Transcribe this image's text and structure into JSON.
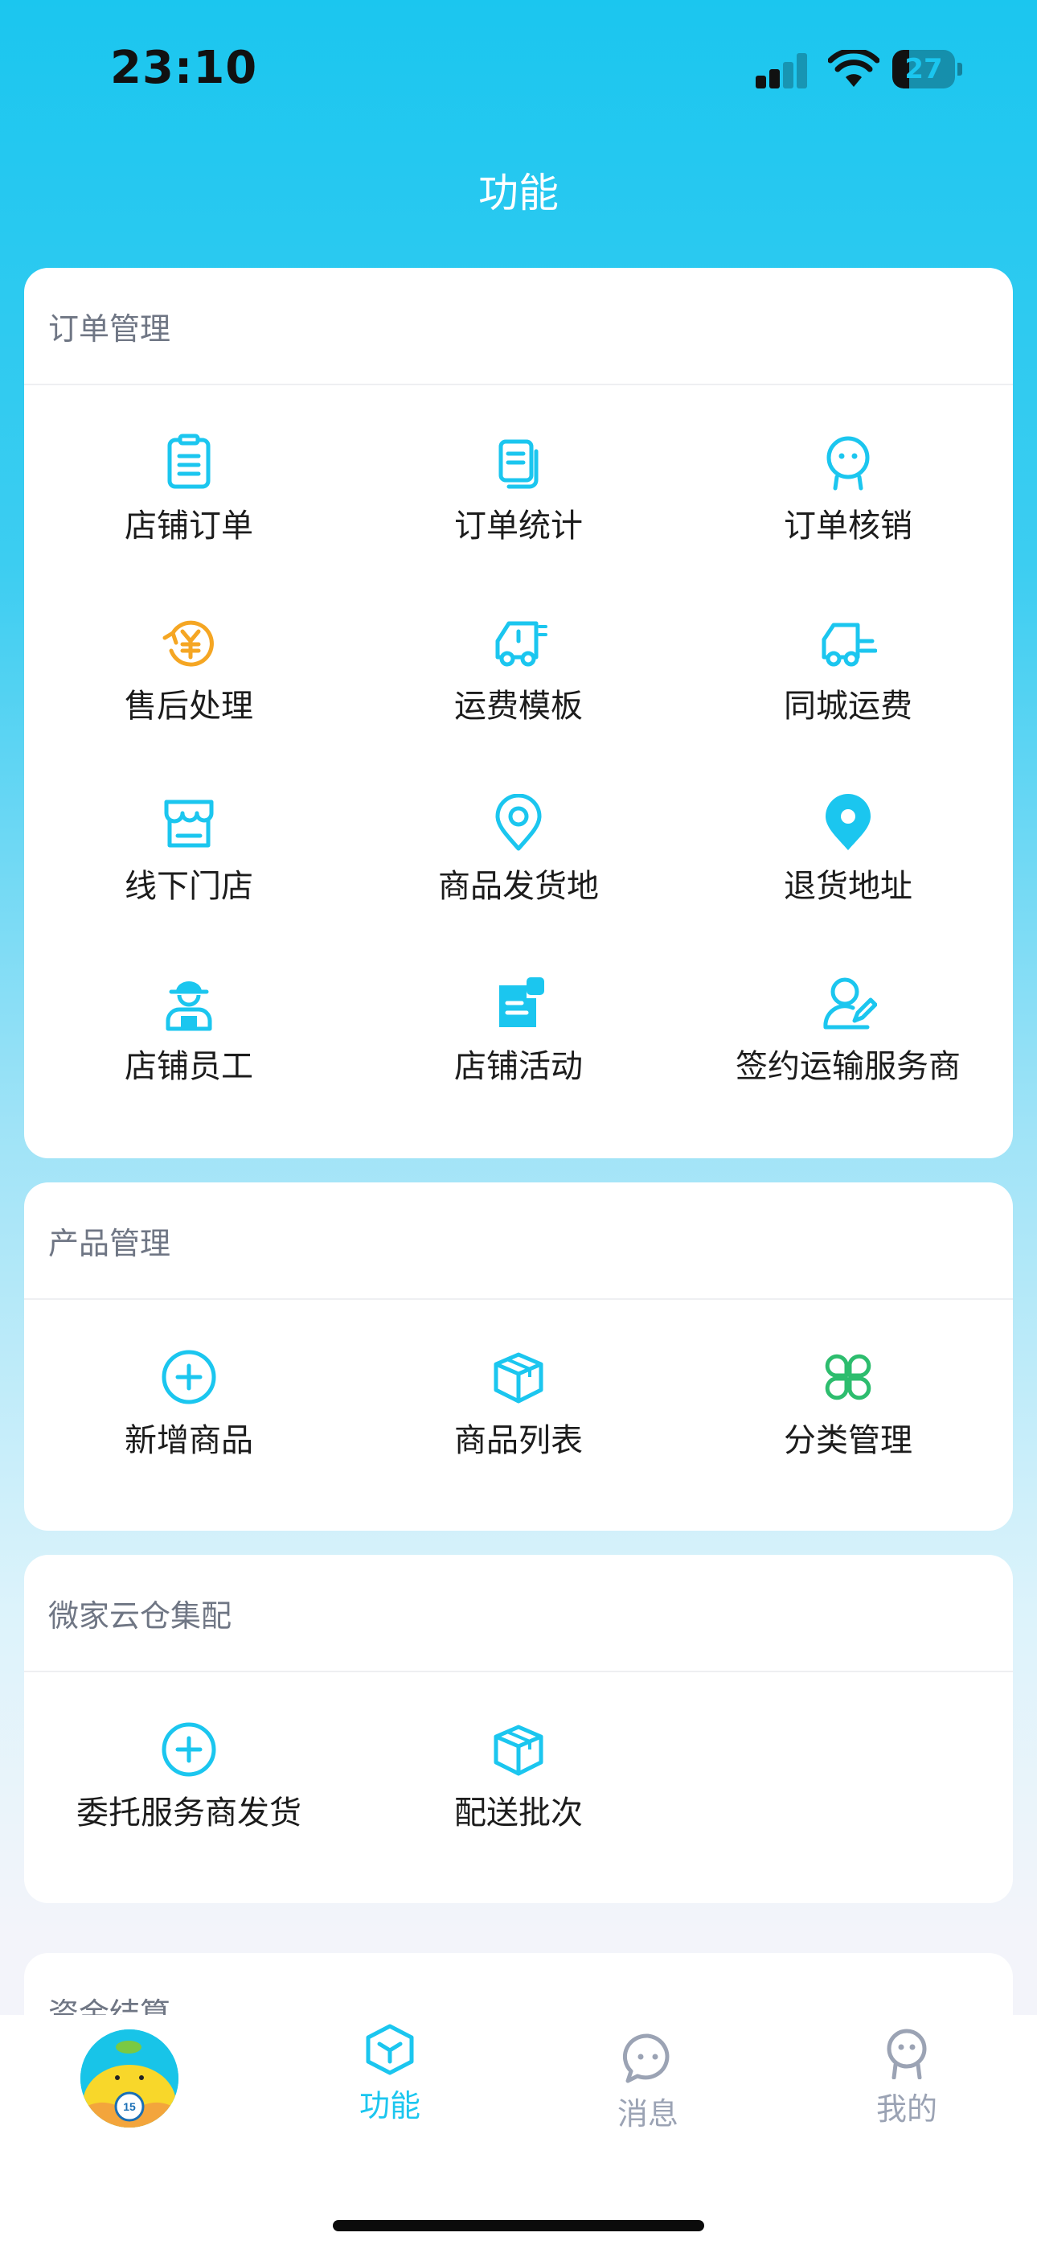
{
  "status_bar": {
    "time": "23:10",
    "battery": "27",
    "battery_level": 0.27
  },
  "page": {
    "title": "功能"
  },
  "sections": [
    {
      "title": "订单管理",
      "items": [
        {
          "label": "店铺订单",
          "icon": "clipboard-icon"
        },
        {
          "label": "订单统计",
          "icon": "documents-icon"
        },
        {
          "label": "订单核销",
          "icon": "person-verify-icon"
        },
        {
          "label": "售后处理",
          "icon": "yuan-refund-icon"
        },
        {
          "label": "运费模板",
          "icon": "delivery-truck-icon"
        },
        {
          "label": "同城运费",
          "icon": "local-delivery-truck-icon"
        },
        {
          "label": "线下门店",
          "icon": "storefront-icon"
        },
        {
          "label": "商品发货地",
          "icon": "location-pin-outline-icon"
        },
        {
          "label": "退货地址",
          "icon": "location-pin-filled-icon"
        },
        {
          "label": "店铺员工",
          "icon": "staff-icon"
        },
        {
          "label": "店铺活动",
          "icon": "activity-note-icon"
        },
        {
          "label": "签约运输服务商",
          "icon": "contract-sign-icon"
        }
      ]
    },
    {
      "title": "产品管理",
      "items": [
        {
          "label": "新增商品",
          "icon": "add-circle-icon"
        },
        {
          "label": "商品列表",
          "icon": "box-icon"
        },
        {
          "label": "分类管理",
          "icon": "category-clover-icon"
        }
      ]
    },
    {
      "title": "微家云仓集配",
      "items": [
        {
          "label": "委托服务商发货",
          "icon": "add-circle-icon"
        },
        {
          "label": "配送批次",
          "icon": "box-icon"
        }
      ]
    },
    {
      "title": "资金结算",
      "items": []
    }
  ],
  "tabbar": {
    "items": [
      {
        "label": "功能",
        "icon": "cube-icon",
        "active": true
      },
      {
        "label": "消息",
        "icon": "chat-bubble-icon",
        "active": false
      },
      {
        "label": "我的",
        "icon": "profile-icon",
        "active": false
      }
    ]
  },
  "colors": {
    "accent": "#1bc6ef",
    "orange": "#f5a623",
    "green": "#2dbd6e",
    "title_gray": "#6f7684"
  }
}
